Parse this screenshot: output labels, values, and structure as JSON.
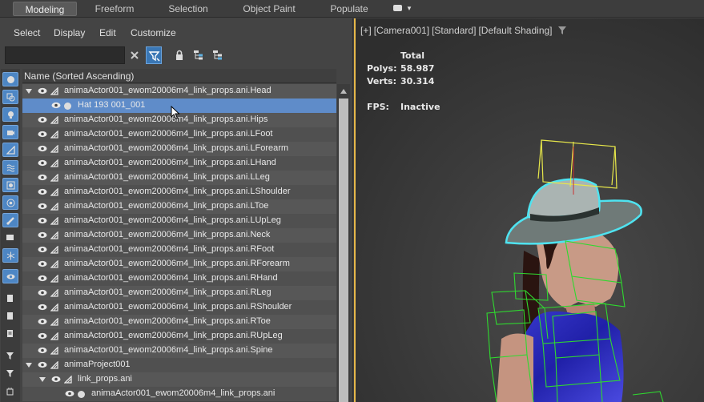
{
  "ribbon": {
    "tabs": [
      "Modeling",
      "Freeform",
      "Selection",
      "Object Paint",
      "Populate"
    ],
    "active": "Modeling"
  },
  "scene_explorer": {
    "menu": [
      "Select",
      "Display",
      "Edit",
      "Customize"
    ],
    "search": {
      "value": "",
      "placeholder": ""
    },
    "column_header": "Name (Sorted Ascending)",
    "rows": [
      {
        "label": "animaActor001_ewom20006m4_link_props.ani.Head",
        "depth": 0,
        "expanded": true,
        "selected": false
      },
      {
        "label": "Hat 193 001_001",
        "depth": 1,
        "expanded": false,
        "selected": true
      },
      {
        "label": "animaActor001_ewom20006m4_link_props.ani.Hips",
        "depth": 0,
        "expanded": false,
        "selected": false
      },
      {
        "label": "animaActor001_ewom20006m4_link_props.ani.LFoot",
        "depth": 0,
        "expanded": false,
        "selected": false
      },
      {
        "label": "animaActor001_ewom20006m4_link_props.ani.LForearm",
        "depth": 0,
        "expanded": false,
        "selected": false
      },
      {
        "label": "animaActor001_ewom20006m4_link_props.ani.LHand",
        "depth": 0,
        "expanded": false,
        "selected": false
      },
      {
        "label": "animaActor001_ewom20006m4_link_props.ani.LLeg",
        "depth": 0,
        "expanded": false,
        "selected": false
      },
      {
        "label": "animaActor001_ewom20006m4_link_props.ani.LShoulder",
        "depth": 0,
        "expanded": false,
        "selected": false
      },
      {
        "label": "animaActor001_ewom20006m4_link_props.ani.LToe",
        "depth": 0,
        "expanded": false,
        "selected": false
      },
      {
        "label": "animaActor001_ewom20006m4_link_props.ani.LUpLeg",
        "depth": 0,
        "expanded": false,
        "selected": false
      },
      {
        "label": "animaActor001_ewom20006m4_link_props.ani.Neck",
        "depth": 0,
        "expanded": false,
        "selected": false
      },
      {
        "label": "animaActor001_ewom20006m4_link_props.ani.RFoot",
        "depth": 0,
        "expanded": false,
        "selected": false
      },
      {
        "label": "animaActor001_ewom20006m4_link_props.ani.RForearm",
        "depth": 0,
        "expanded": false,
        "selected": false
      },
      {
        "label": "animaActor001_ewom20006m4_link_props.ani.RHand",
        "depth": 0,
        "expanded": false,
        "selected": false
      },
      {
        "label": "animaActor001_ewom20006m4_link_props.ani.RLeg",
        "depth": 0,
        "expanded": false,
        "selected": false
      },
      {
        "label": "animaActor001_ewom20006m4_link_props.ani.RShoulder",
        "depth": 0,
        "expanded": false,
        "selected": false
      },
      {
        "label": "animaActor001_ewom20006m4_link_props.ani.RToe",
        "depth": 0,
        "expanded": false,
        "selected": false
      },
      {
        "label": "animaActor001_ewom20006m4_link_props.ani.RUpLeg",
        "depth": 0,
        "expanded": false,
        "selected": false
      },
      {
        "label": "animaActor001_ewom20006m4_link_props.ani.Spine",
        "depth": 0,
        "expanded": false,
        "selected": false
      },
      {
        "label": "animaProject001",
        "depth": 0,
        "expanded": true,
        "selected": false
      },
      {
        "label": "link_props.ani",
        "depth": 1,
        "expanded": true,
        "selected": false
      },
      {
        "label": "animaActor001_ewom20006m4_link_props.ani",
        "depth": 2,
        "expanded": false,
        "selected": false
      }
    ]
  },
  "viewport": {
    "label_parts": [
      "[+]",
      "[Camera001]",
      "[Standard]",
      "[Default Shading]"
    ],
    "stats": {
      "total_header": "Total",
      "polys_label": "Polys:",
      "polys_value": "58.987",
      "verts_label": "Verts:",
      "verts_value": "30.314",
      "fps_label": "FPS:",
      "fps_value": "Inactive"
    }
  },
  "icons": [
    "filter-icon",
    "close-icon",
    "lock-icon",
    "hierarchy-icon",
    "eye-icon",
    "bone-icon",
    "funnel-icon"
  ],
  "colors": {
    "accent_blue": "#5f8cc9",
    "viewport_border": "#e6b84a",
    "wire_green": "#2fd92f",
    "selection_cyan": "#4fe3f0",
    "bbox_yellow": "#e8e84a"
  }
}
